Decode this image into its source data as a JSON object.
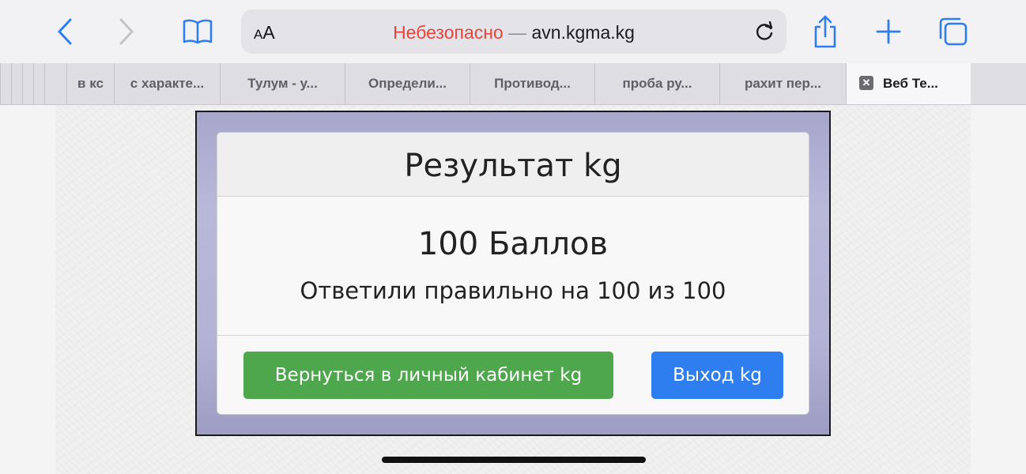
{
  "toolbar": {
    "url_security": "Небезопасно",
    "url_separator": " — ",
    "url_host": "avn.kgma.kg",
    "aa_small": "A",
    "aa_big": "A"
  },
  "tabs": [
    {
      "label": "в кс"
    },
    {
      "label": "с характе..."
    },
    {
      "label": "Тулум - у..."
    },
    {
      "label": "Определи..."
    },
    {
      "label": "Противод..."
    },
    {
      "label": "проба ру..."
    },
    {
      "label": "рахит пер..."
    },
    {
      "label": "Веб Те...",
      "active": true
    }
  ],
  "result": {
    "title": "Результат kg",
    "score": "100 Баллов",
    "answered": "Ответили правильно на 100 из 100",
    "back_button": "Вернуться в личный кабинет kg",
    "exit_button": "Выход kg"
  },
  "colors": {
    "insecure": "#e8443a",
    "accent": "#2f7ef0",
    "green": "#4ea64d"
  }
}
